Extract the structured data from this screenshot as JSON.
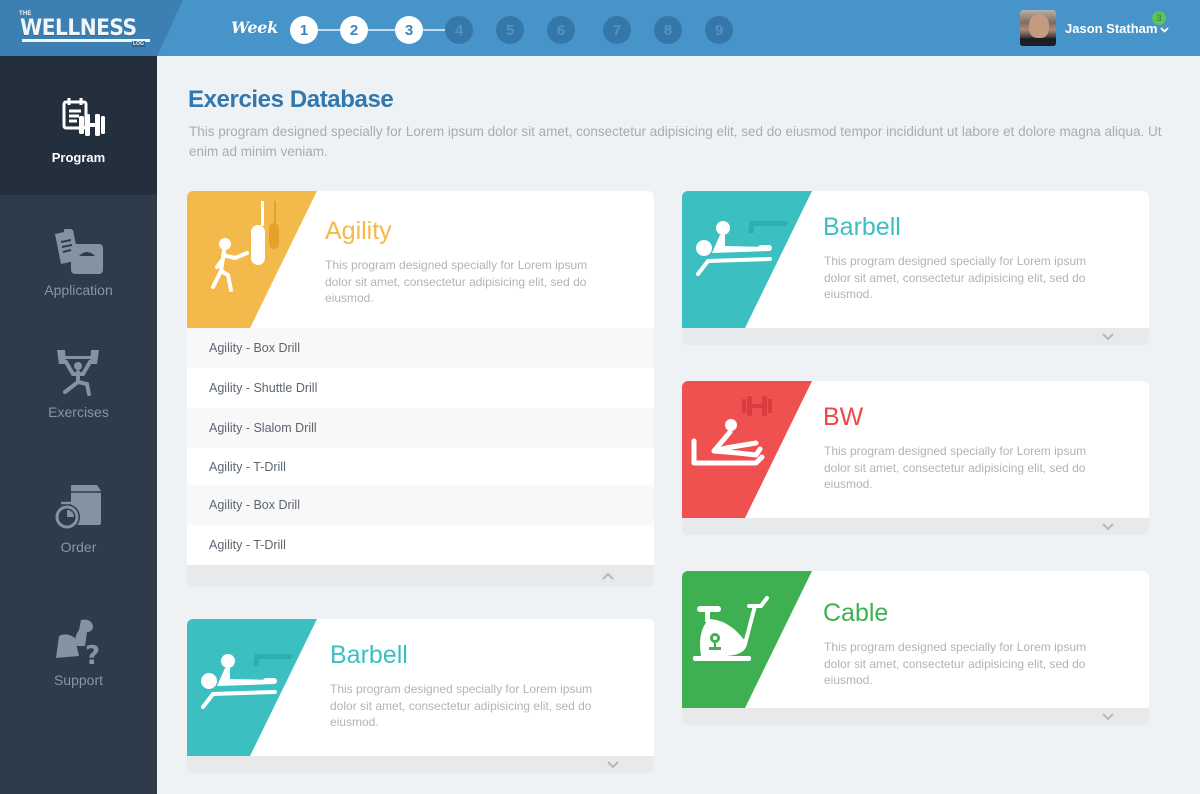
{
  "app": {
    "logo": {
      "the": "THE",
      "word": "WELLNESS",
      "log": "LOG"
    },
    "week_label": "Week",
    "weeks": [
      {
        "n": "1",
        "state": "done"
      },
      {
        "n": "2",
        "state": "done"
      },
      {
        "n": "3",
        "state": "done"
      },
      {
        "n": "4",
        "state": "todo"
      },
      {
        "n": "5",
        "state": "todo"
      },
      {
        "n": "6",
        "state": "todo"
      },
      {
        "n": "7",
        "state": "todo"
      },
      {
        "n": "8",
        "state": "todo"
      },
      {
        "n": "9",
        "state": "todo"
      }
    ],
    "user": {
      "name": "Jason Statham",
      "notifications": "3",
      "menu_icon": "chevron-down-icon"
    }
  },
  "sidebar": {
    "items": [
      {
        "label": "Program",
        "icon": "program-icon",
        "active": true
      },
      {
        "label": "Application",
        "icon": "application-icon",
        "active": false
      },
      {
        "label": "Exercises",
        "icon": "exercises-icon",
        "active": false
      },
      {
        "label": "Order",
        "icon": "order-icon",
        "active": false
      },
      {
        "label": "Support",
        "icon": "support-icon",
        "active": false
      }
    ]
  },
  "main": {
    "title": "Exercies Database",
    "description": "This program designed specially for Lorem ipsum dolor sit amet, consectetur adipisicing elit, sed do eiusmod tempor incididunt ut labore et dolore magna aliqua. Ut enim ad minim veniam.",
    "cards": [
      {
        "title": "Agility",
        "description": "This program designed specially for Lorem ipsum dolor sit amet, consectetur adipisicing elit, sed do eiusmod.",
        "color": "#f3b94a",
        "icon": "boxing-bag-icon",
        "expanded": true,
        "items": [
          "Agility - Box Drill",
          "Agility - Shuttle Drill",
          "Agility - Slalom Drill",
          "Agility - T-Drill",
          "Agility - Box Drill",
          "Agility - T-Drill"
        ]
      },
      {
        "title": "Barbell",
        "description": "This program designed specially for Lorem ipsum dolor sit amet, consectetur adipisicing elit, sed do eiusmod.",
        "color": "#3cbfc1",
        "icon": "bench-press-icon",
        "expanded": false
      },
      {
        "title": "Barbell",
        "description": "This program designed specially for Lorem ipsum dolor sit amet, consectetur adipisicing elit, sed do eiusmod.",
        "color": "#3cbfc1",
        "icon": "bench-press-icon",
        "expanded": false
      },
      {
        "title": "BW",
        "description": "This program designed specially for Lorem ipsum dolor sit amet, consectetur adipisicing elit, sed do eiusmod.",
        "color": "#ef5050",
        "icon": "rowing-icon",
        "expanded": false
      },
      {
        "title": "Cable",
        "description": "This program designed specially for Lorem ipsum dolor sit amet, consectetur adipisicing elit, sed do eiusmod.",
        "color": "#3fb052",
        "icon": "exercise-bike-icon",
        "expanded": false
      }
    ]
  },
  "colors": {
    "topbar": "#4694ca",
    "sidebar": "#2d3b4a",
    "sidebar_active": "#232f3c",
    "title": "#3278ae",
    "badge": "#5ec25b"
  }
}
